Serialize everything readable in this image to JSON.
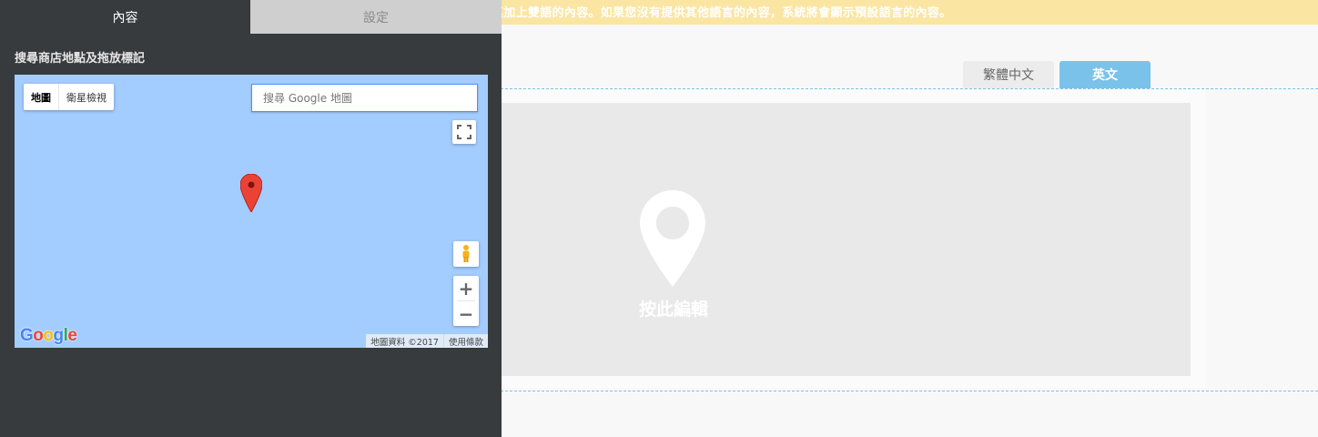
{
  "notice": {
    "text": "真加上雙語的內容。如果您沒有提供其他語言的內容，系統將會顯示預設語言的內容。"
  },
  "language_tabs": [
    {
      "label": "繁體中文",
      "active": false
    },
    {
      "label": "英文",
      "active": true
    }
  ],
  "placeholder": {
    "label": "按此編輯",
    "icon": "map-pin-icon"
  },
  "panel": {
    "tabs": [
      {
        "label": "內容",
        "active": true
      },
      {
        "label": "設定",
        "active": false
      }
    ],
    "heading": "搜尋商店地點及拖放標記"
  },
  "map": {
    "maptype_map": "地圖",
    "maptype_satellite": "衛星檢視",
    "search_placeholder": "搜尋 Google 地圖",
    "zoom_in": "+",
    "zoom_out": "−",
    "logo": "Google",
    "attribution": "地圖資料 ©2017",
    "terms": "使用條款",
    "water_color": "#a3ccff",
    "marker_color": "#ea4335"
  },
  "colors": {
    "panel_bg": "#373b3e",
    "notice_bg": "#fbe5a2",
    "active_lang_tab": "#7bc2ea"
  }
}
